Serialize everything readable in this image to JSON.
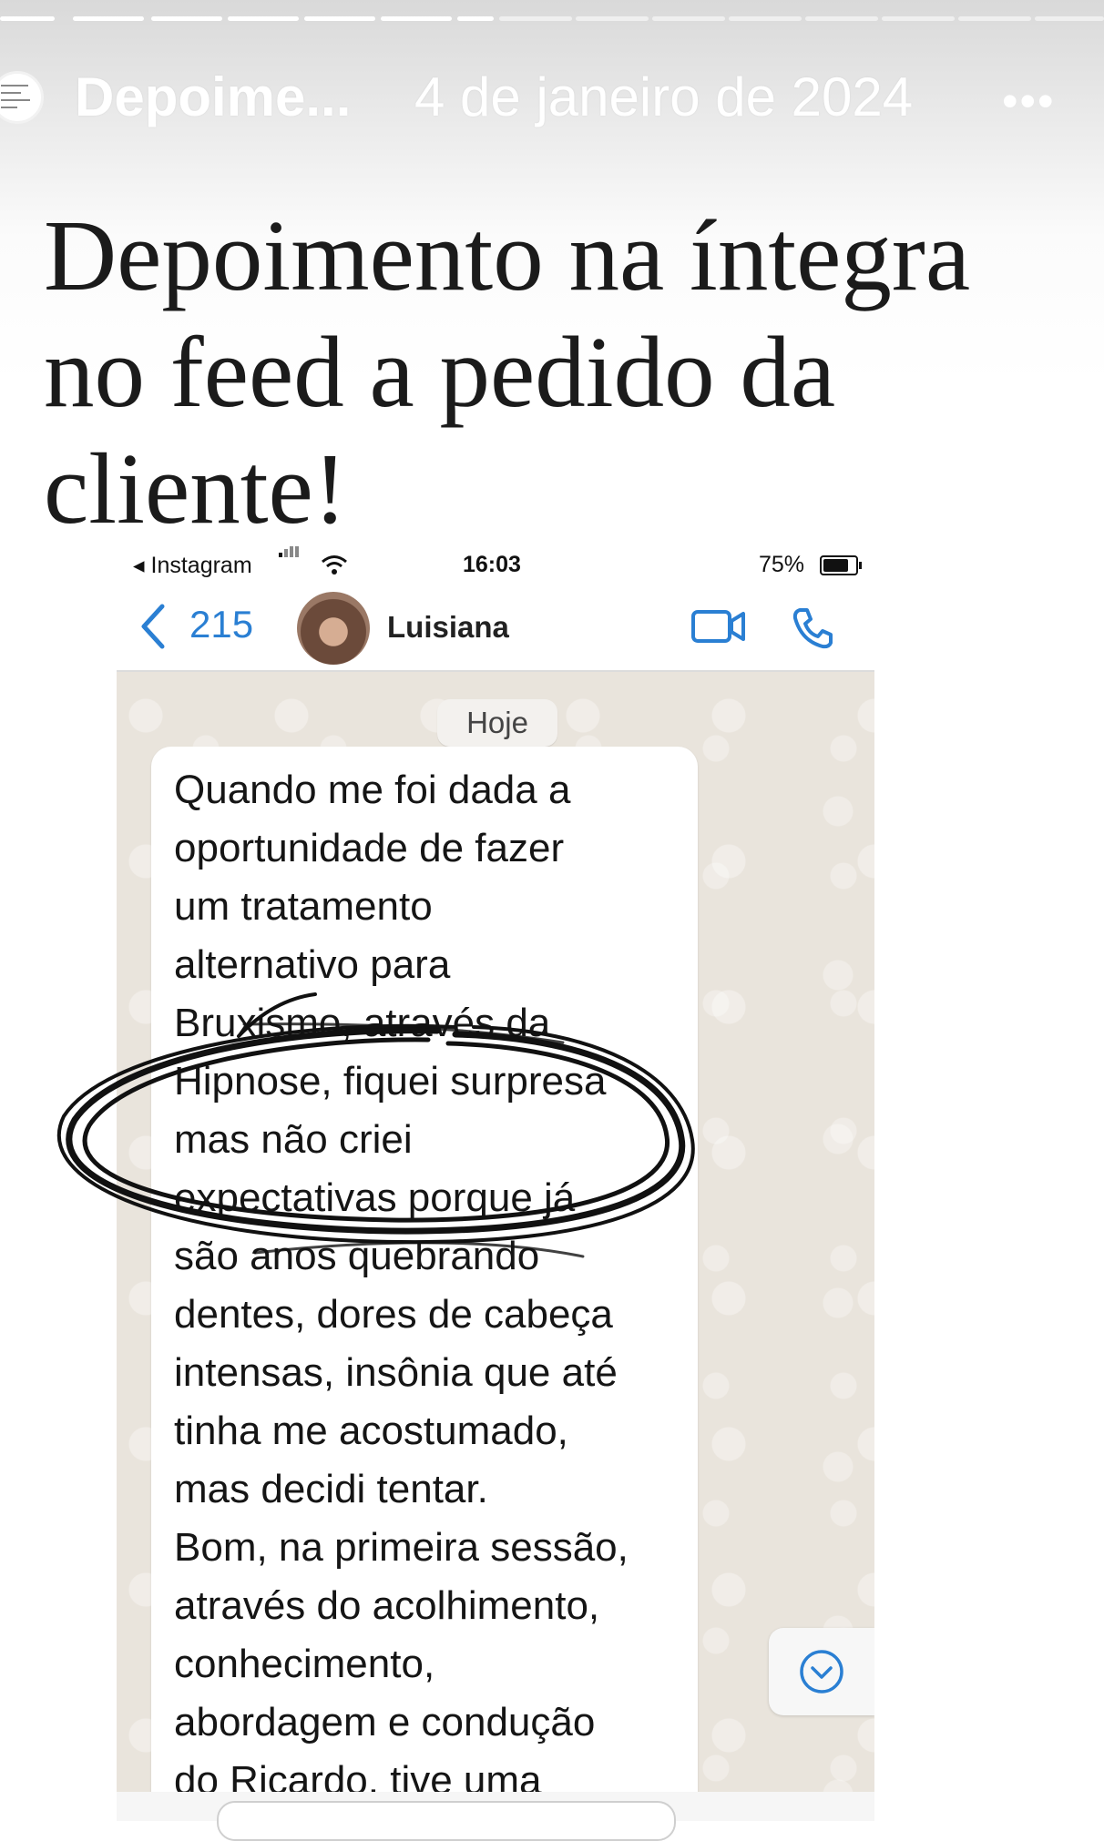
{
  "story": {
    "account_name": "Depoime...",
    "date": "4 de janeiro de 2024",
    "more_icon": "more-icon",
    "caption_lines": [
      "Depoimento na íntegra",
      "no feed a pedido da",
      "cliente!"
    ]
  },
  "embedded_screenshot": {
    "status_bar": {
      "back_app": "◂ Instagram",
      "time": "16:03",
      "battery": "75%"
    },
    "chat_header": {
      "unread_count": "215",
      "contact_name": "Luisiana",
      "icons": [
        "back-chevron-icon",
        "video-call-icon",
        "phone-call-icon"
      ]
    },
    "date_label": "Hoje",
    "message_lines": [
      "Quando me foi dada a",
      "oportunidade de fazer",
      "um tratamento",
      "alternativo para",
      "Bruxismo, através da",
      "Hipnose, fiquei surpresa",
      "mas não criei",
      "expectativas porque já",
      "são anos quebrando",
      "dentes, dores de cabeça",
      "intensas, insônia que até",
      "tinha me acostumado,",
      "mas decidi tentar.",
      "Bom, na primeira sessão,",
      "através do acolhimento,",
      "conhecimento,",
      "abordagem e condução",
      "do Ricardo, tive uma"
    ]
  },
  "colors": {
    "link_blue": "#2a7fd3",
    "chat_background": "#e9e4dc",
    "annotation_ink": "#111111"
  }
}
